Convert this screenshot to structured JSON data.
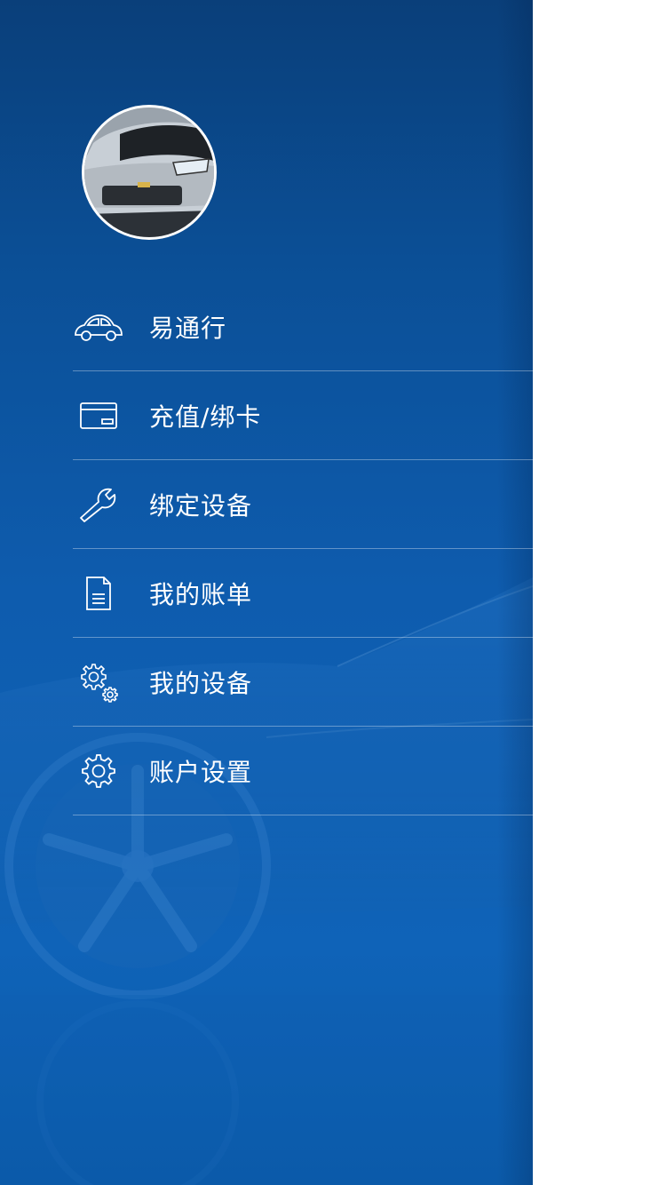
{
  "menu": {
    "items": [
      {
        "label": "易通行",
        "icon": "car-icon"
      },
      {
        "label": "充值/绑卡",
        "icon": "card-icon"
      },
      {
        "label": "绑定设备",
        "icon": "wrench-icon"
      },
      {
        "label": "我的账单",
        "icon": "document-icon"
      },
      {
        "label": "我的设备",
        "icon": "gears-icon"
      },
      {
        "label": "账户设置",
        "icon": "gear-icon"
      }
    ]
  },
  "colors": {
    "drawer_bg": "#0e5cae",
    "text": "#ffffff",
    "divider": "#8fb4dc",
    "page_bg": "#ffffff"
  }
}
